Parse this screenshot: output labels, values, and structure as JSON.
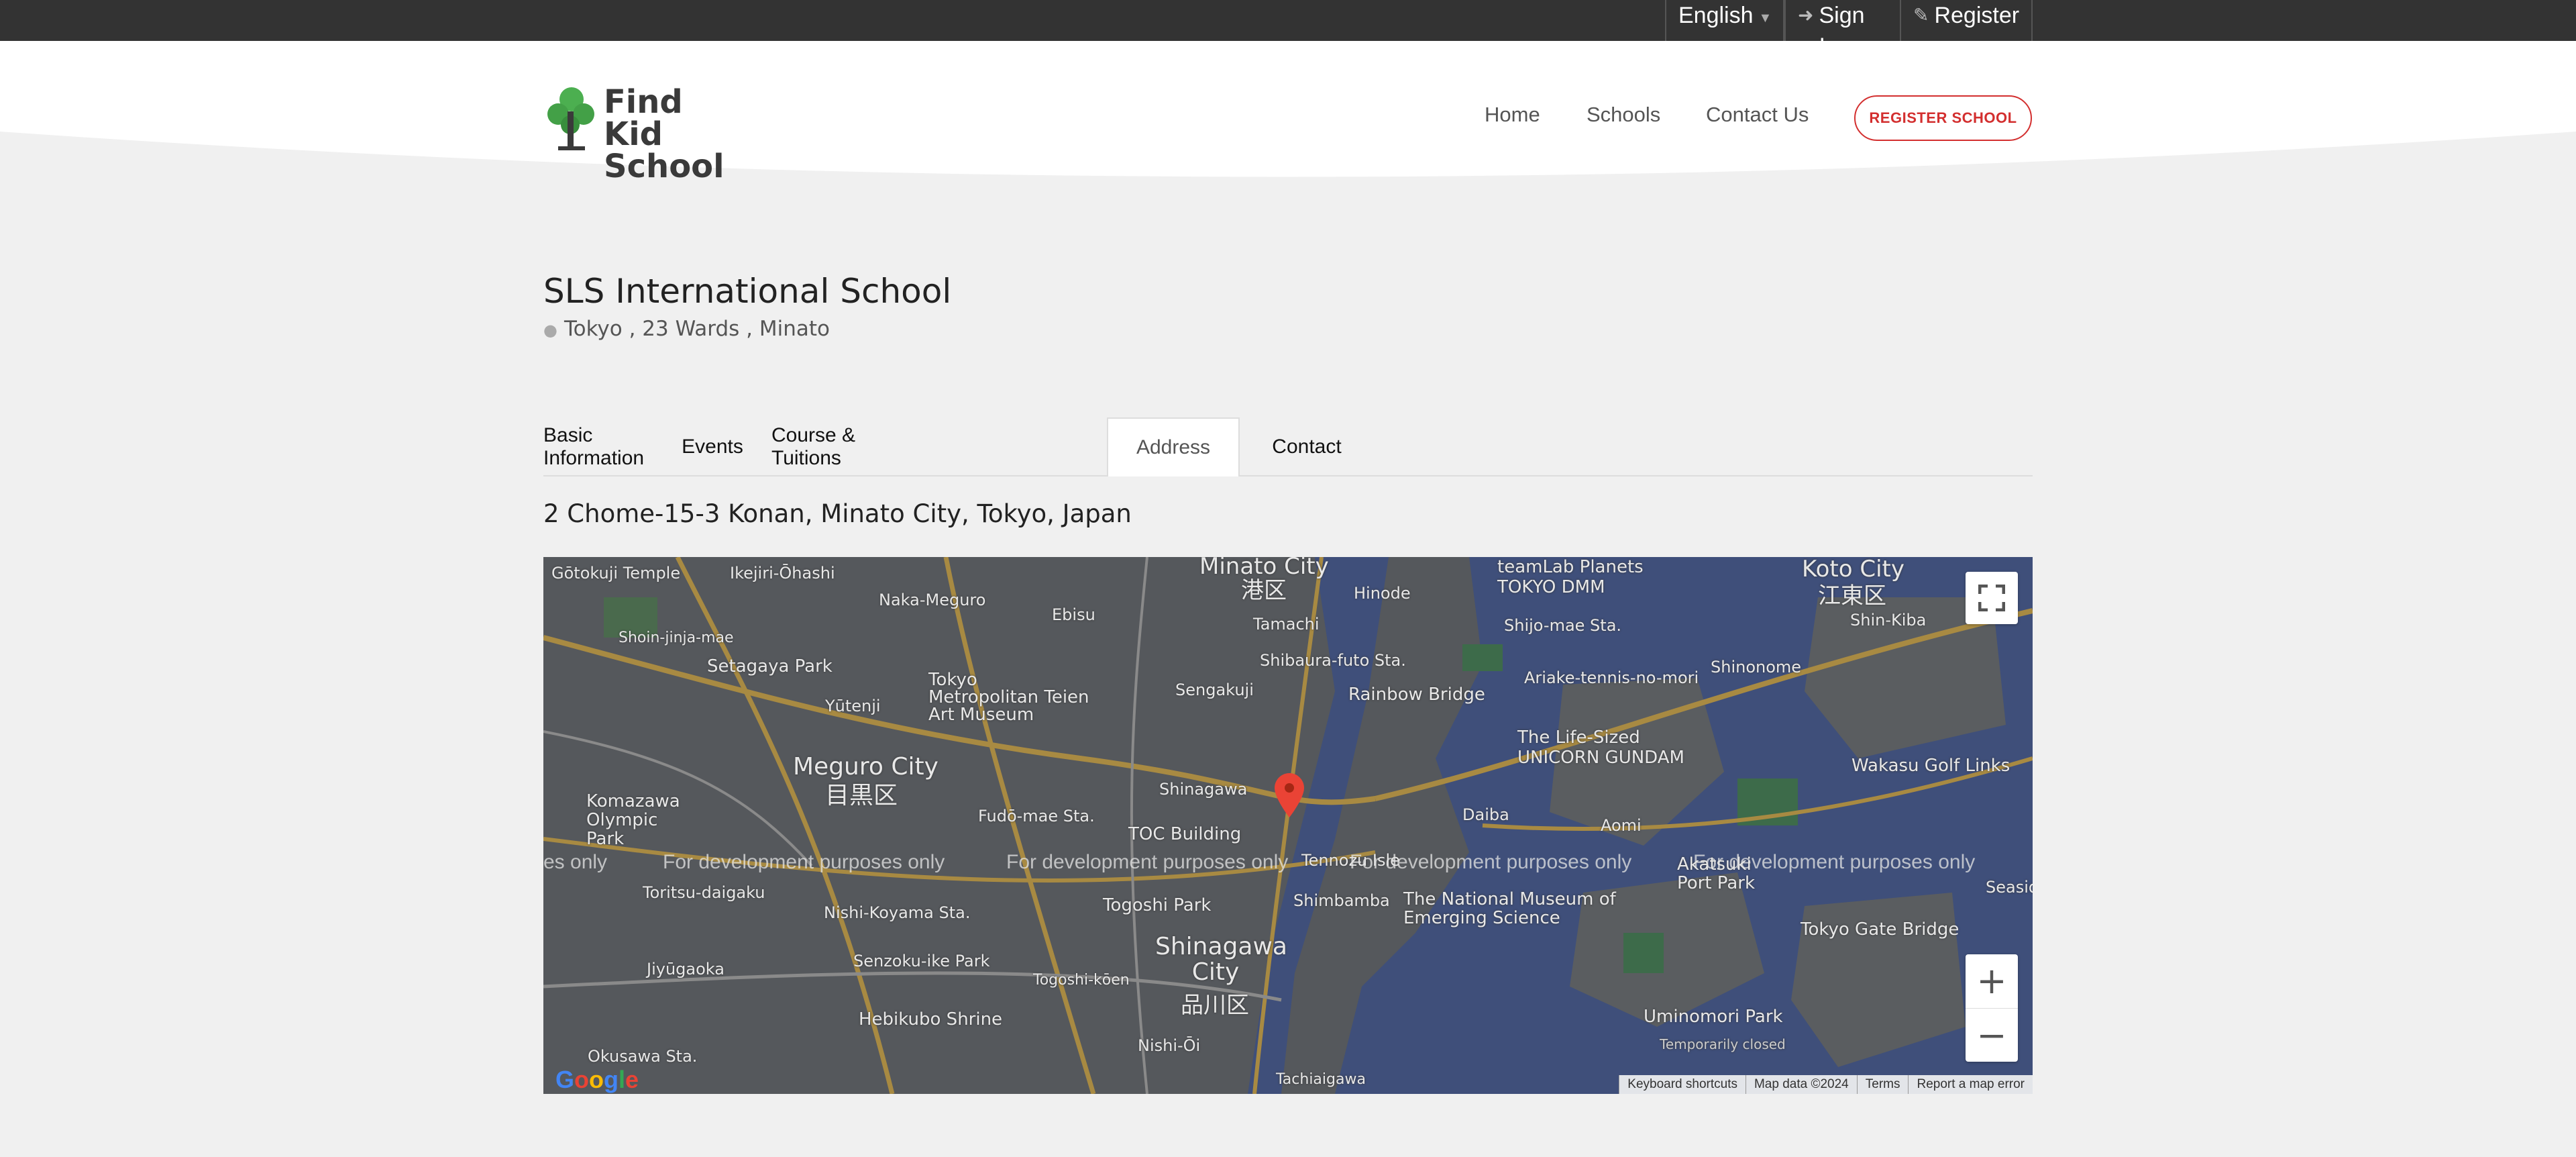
{
  "topbar": {
    "language": "English",
    "sign_in": "Sign In",
    "register": "Register"
  },
  "header": {
    "logo_line1": "Find Kid",
    "logo_line2": "School",
    "nav": [
      "Home",
      "Schools",
      "Contact Us"
    ],
    "register_school": "REGISTER SCHOOL"
  },
  "school": {
    "name": "SLS International School",
    "location": "Tokyo , 23 Wards , Minato"
  },
  "tabs": [
    {
      "label": "Basic Information",
      "active": false
    },
    {
      "label": "Events",
      "active": false
    },
    {
      "label": "Course & Tuitions",
      "active": false
    },
    {
      "label": "Address",
      "active": true
    },
    {
      "label": "Contact",
      "active": false
    }
  ],
  "address": "2 Chome-15-3 Konan, Minato City, Tokyo, Japan",
  "map": {
    "watermark": "For development purposes only",
    "watermark_clipped": "es only",
    "labels": {
      "minato_city": "Minato City",
      "minato_ja": "港区",
      "koto_city": "Koto City",
      "koto_ja": "江東区",
      "meguro_city": "Meguro City",
      "meguro_ja": "目黒区",
      "shinagawa_city": "Shinagawa City",
      "shinagawa_ja": "品川区",
      "gotokuji": "Gōtokuji Temple",
      "ikejiri": "Ikejiri-Ōhashi",
      "naka_meguro": "Naka-Meguro",
      "ebisu": "Ebisu",
      "setagaya_park": "Setagaya Park",
      "yutenji": "Yūtenji",
      "teien": "Tokyo Metropolitan Teien Art Museum",
      "sengakuji": "Sengakuji",
      "rainbow": "Rainbow Bridge",
      "teamlab": "teamLab Planets TOKYO DMM",
      "shijo_mae": "Shijo-mae Sta.",
      "shinonome": "Shinonome",
      "shin_kiba": "Shin-Kiba",
      "ariake": "Ariake-tennis-no-mori",
      "gundam": "The Life-Sized UNICORN GUNDAM",
      "wakasu": "Wakasu Golf Links",
      "shibaura": "Shibaura-futo Sta.",
      "tamachi": "Tamachi",
      "hinode": "Hinode",
      "shinagawa": "Shinagawa",
      "toc": "TOC Building",
      "fudo_mae": "Fudō-mae Sta.",
      "komazawa": "Komazawa Olympic Park",
      "toritsu": "Toritsu-daigaku",
      "nishi_koyama": "Nishi-Koyama Sta.",
      "togoshi": "Togoshi Park",
      "minato_koike": "Senzoku-ike Park",
      "tennozu": "Tennozu Isle",
      "shimbamba": "Shimbamba",
      "museum": "The National Museum of Emerging Science",
      "daiba": "Daiba",
      "aomi": "Aomi",
      "akatsuki": "Akatsuki Port Park",
      "tokyo_gate": "Tokyo Gate Bridge",
      "umi_no_mori": "Uminomori Park",
      "temporarily": "Temporarily closed",
      "hebikubo": "Hebikubo Shrine",
      "nishi_oi": "Nishi-Ōi",
      "okusawa": "Okusawa Sta.",
      "jiyugaoka": "Jiyūgaoka",
      "tachiaigawa": "Tachiaigawa",
      "shoin": "Shoin-jinja-mae",
      "seaside": "Seaside P",
      "togoshi_koen": "Togoshi-kōen"
    },
    "attribution": [
      "Keyboard shortcuts",
      "Map data ©2024",
      "Terms",
      "Report a map error"
    ],
    "google": "Google"
  },
  "colors": {
    "accent_red": "#d32f2f",
    "topbar": "#333333",
    "page_bg": "#f0f0f0"
  }
}
